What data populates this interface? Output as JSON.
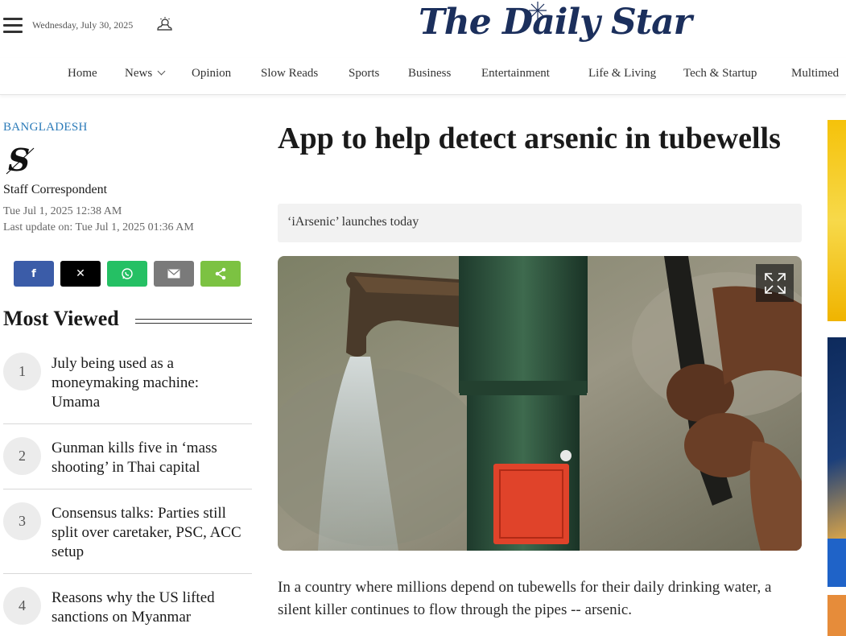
{
  "header": {
    "date": "Wednesday, July 30, 2025",
    "logo_text": "The Daily Star",
    "weather_icon": "cloud-sun-icon",
    "brand_color": "#1b2f5c"
  },
  "nav": {
    "items": [
      {
        "label": "Home"
      },
      {
        "label": "News",
        "has_dropdown": true
      },
      {
        "label": "Opinion"
      },
      {
        "label": "Slow Reads"
      },
      {
        "label": "Sports"
      },
      {
        "label": "Business"
      },
      {
        "label": "Entertainment"
      },
      {
        "label": "Life & Living"
      },
      {
        "label": "Tech & Startup"
      },
      {
        "label": "Multimed"
      }
    ]
  },
  "article": {
    "category": "BANGLADESH",
    "author": "Staff Correspondent",
    "published": "Tue Jul 1, 2025 12:38 AM",
    "updated": "Last update on: Tue Jul 1, 2025 01:36 AM",
    "headline": "App to help detect arsenic in tubewells",
    "subhead": "‘iArsenic’ launches today",
    "body": "In a country where millions depend on tubewells for their daily drinking water, a silent killer continues to flow through the pipes -- arsenic.",
    "category_color": "#2a7ab8"
  },
  "share": [
    {
      "name": "facebook",
      "glyph": "f",
      "color": "#3b5ca8"
    },
    {
      "name": "x",
      "glyph": "𝕏",
      "color": "#000000"
    },
    {
      "name": "whatsapp",
      "glyph": "✆",
      "color": "#25c064"
    },
    {
      "name": "email",
      "glyph": "✉",
      "color": "#7a7a7a"
    },
    {
      "name": "share",
      "glyph": "⋖",
      "color": "#7cc242"
    }
  ],
  "most_viewed": {
    "title": "Most Viewed",
    "items": [
      {
        "rank": "1",
        "title": "July being used as a moneymaking machine: Umama"
      },
      {
        "rank": "2",
        "title": "Gunman kills five in ‘mass shooting’ in Thai capital"
      },
      {
        "rank": "3",
        "title": "Consensus talks: Parties still split over caretaker, PSC, ACC setup"
      },
      {
        "rank": "4",
        "title": "Reasons why the US lifted sanctions on Myanmar"
      }
    ]
  }
}
